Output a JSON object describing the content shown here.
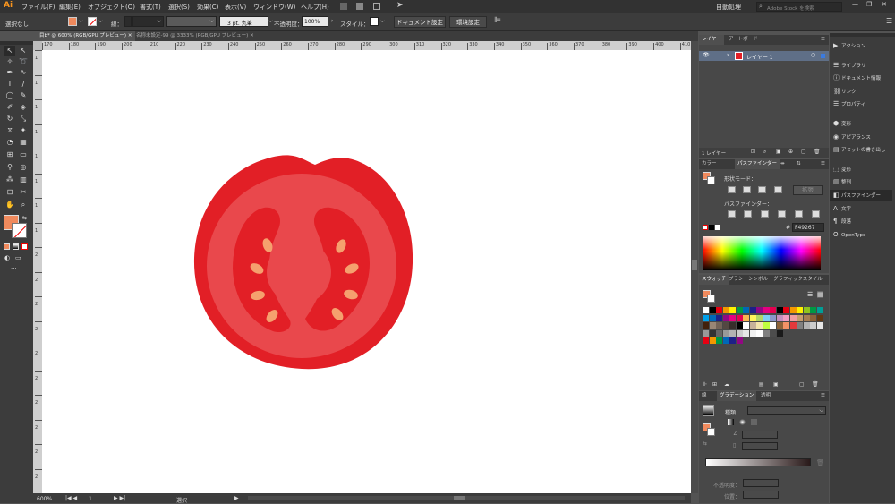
{
  "app": {
    "logo": "Ai"
  },
  "menu": [
    "ファイル(F)",
    "編集(E)",
    "オブジェクト(O)",
    "書式(T)",
    "選択(S)",
    "効果(C)",
    "表示(V)",
    "ウィンドウ(W)",
    "ヘルプ(H)"
  ],
  "workspace": "自動処理",
  "search": {
    "placeholder": "Adobe Stock を検索"
  },
  "control": {
    "selection": "選択なし",
    "stroke_label": "線：",
    "stroke_profile": "3 pt. 丸筆",
    "opacity_label": "不透明度：",
    "opacity_value": "100%",
    "style_label": "スタイル：",
    "doc_setup": "ドキュメント設定",
    "prefs": "環境設定",
    "fill_color": "#F08A5D"
  },
  "doc_tabs": [
    "目b* @ 600% (RGB/GPU プレビュー)",
    "名称未設定-99 @ 3333% (RGB/GPU プレビュー)"
  ],
  "ruler_h": [
    "170",
    "180",
    "190",
    "200",
    "210",
    "220",
    "230",
    "240",
    "250",
    "260",
    "270",
    "280",
    "290",
    "300",
    "310",
    "320",
    "330",
    "340",
    "350",
    "360",
    "370",
    "380",
    "390",
    "400",
    "410"
  ],
  "ruler_v": [
    "1",
    "1",
    "1",
    "1",
    "1",
    "1",
    "1",
    "1",
    "2",
    "2",
    "2",
    "2",
    "2",
    "2",
    "2",
    "2",
    "2",
    "2"
  ],
  "status": {
    "zoom": "600%",
    "artboard": "1",
    "tool": "選択"
  },
  "layers": {
    "tabs": [
      "レイヤー",
      "アートボード"
    ],
    "layer_name": "レイヤー 1",
    "footer": "1 レイヤー"
  },
  "pathfinder": {
    "tabs": [
      "カラー",
      "パスファインダー",
      "",
      ""
    ],
    "shape_modes": "形状モード：",
    "expand": "拡張",
    "pathfinders": "パスファインダー："
  },
  "color": {
    "hex_label": "#",
    "hex_value": "F49267"
  },
  "swatches": {
    "tabs": [
      "スウォッチ",
      "ブラシ",
      "シンボル",
      "グラフィックスタイル"
    ],
    "row1": [
      "#ffffff",
      "#000000",
      "#e60012",
      "#f39800",
      "#fff100",
      "#009944",
      "#0068b7",
      "#1d2088",
      "#920783",
      "#e4007f",
      "#e5004f",
      "#000000",
      "#e60012",
      "#f39800",
      "#fff100",
      "#8fc31f",
      "#009944",
      "#009e96"
    ],
    "row2": [
      "#00a0e9",
      "#0068b7",
      "#1d2088",
      "#920783",
      "#e4007f",
      "#e5004f",
      "#f8b551",
      "#fff45c",
      "#b3d465",
      "#7ecef4",
      "#8c97cb",
      "#c490bf",
      "#f19ec2",
      "#f29c9f",
      "#c69c6d",
      "#a67c52",
      "#8c6239",
      "#603813"
    ],
    "row3": [
      "#42210b",
      "#998675",
      "#736357",
      "#534741",
      "#362e2b",
      "#000000",
      "#ffffff",
      "#c7b299",
      "#f3e5ab",
      "#c0ff3e",
      "#ffffff",
      "#8c6239",
      "#f49267",
      "#e4393c",
      "#808080",
      "#b3b3b3",
      "#cccccc",
      "#e6e6e6"
    ],
    "row4": [
      "#999999",
      "#333333",
      "#666666",
      "#999999",
      "#b3b3b3",
      "#cccccc",
      "#e6e6e6",
      "#f2f2f2",
      "#ffffff",
      "#808080",
      "#4d4d4d",
      "#1a1a1a"
    ],
    "row5": [
      "#e60012",
      "#f39800",
      "#009944",
      "#0068b7",
      "#1d2088",
      "#920783"
    ]
  },
  "gradient": {
    "tabs": [
      "線",
      "グラデーション",
      "透明"
    ],
    "type_label": "種類：",
    "opacity_label": "不透明度：",
    "position_label": "位置："
  },
  "dock": [
    {
      "icon": "▶",
      "label": "アクション"
    },
    {
      "icon": "☰",
      "label": "ライブラリ"
    },
    {
      "icon": "ⓘ",
      "label": "ドキュメント情報"
    },
    {
      "icon": "⛓",
      "label": "リンク"
    },
    {
      "icon": "☰",
      "label": "プロパティ"
    },
    {
      "icon": "⬢",
      "label": "変形"
    },
    {
      "icon": "◉",
      "label": "アピアランス"
    },
    {
      "icon": "▤",
      "label": "アセットの書き出し"
    },
    {
      "icon": "⬚",
      "label": "変形"
    },
    {
      "icon": "▥",
      "label": "整列"
    },
    {
      "icon": "◧",
      "label": "パスファインダー"
    },
    {
      "icon": "A",
      "label": "文字"
    },
    {
      "icon": "¶",
      "label": "段落"
    },
    {
      "icon": "O",
      "label": "OpenType"
    }
  ],
  "tomato": {
    "skin": "#E21F26",
    "flesh": "#E9484C",
    "seed": "#F5A06E"
  }
}
